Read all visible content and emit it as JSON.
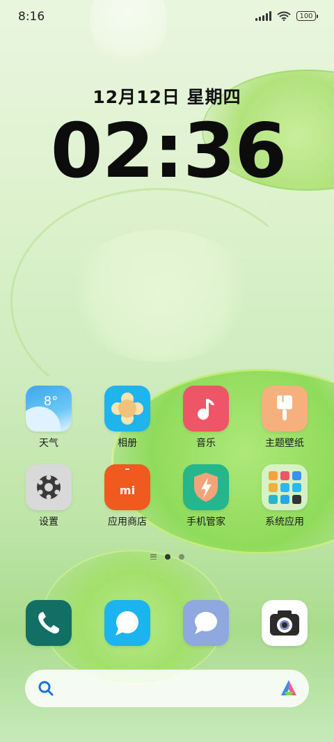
{
  "status_bar": {
    "time": "8:16",
    "battery": "100"
  },
  "lockscreen": {
    "date": "12月12日 星期四",
    "clock": "02:36"
  },
  "apps_row1": [
    {
      "label": "天气",
      "badge": "8°"
    },
    {
      "label": "相册"
    },
    {
      "label": "音乐"
    },
    {
      "label": "主题壁纸"
    }
  ],
  "apps_row2": [
    {
      "label": "设置"
    },
    {
      "label": "应用商店",
      "badge": "mi"
    },
    {
      "label": "手机管家"
    },
    {
      "label": "系统应用"
    }
  ],
  "dock": [
    "phone",
    "messages-blue",
    "messages-lilac",
    "camera"
  ],
  "colors": {
    "weather": "#3fb4ef",
    "gallery": "#2bb7ef",
    "music": "#ee5566",
    "theme": "#f5b07e",
    "settings": "#dcdcdc",
    "store": "#f15a1e",
    "security": "#25b68c",
    "phone": "#116f63"
  }
}
